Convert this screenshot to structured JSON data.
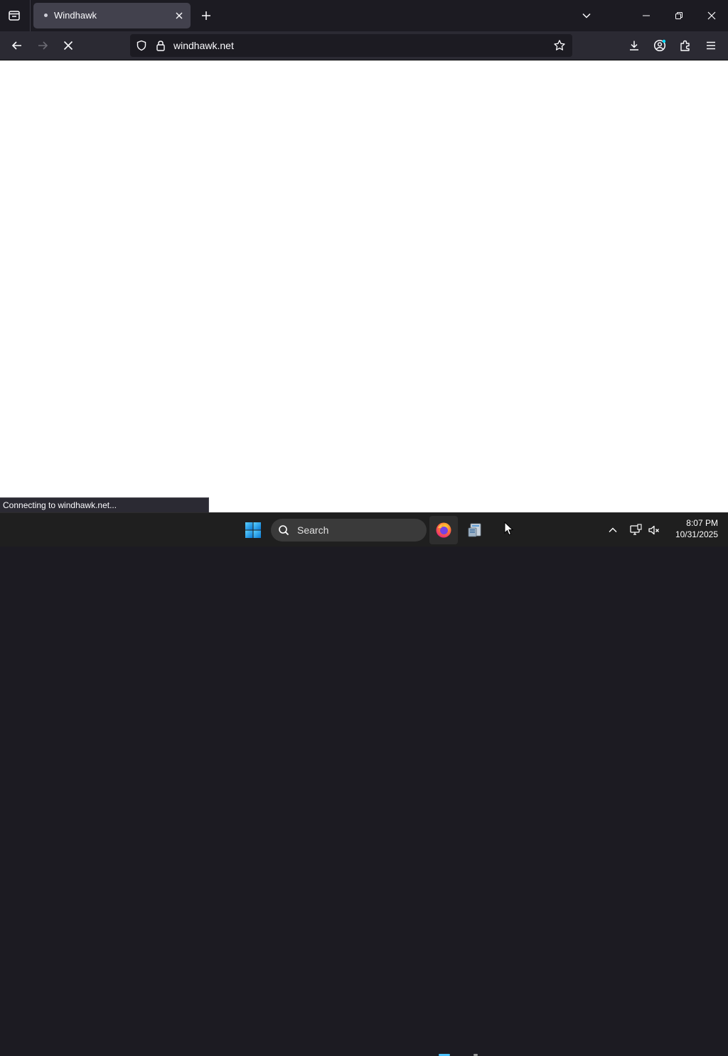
{
  "tabs": [
    {
      "title": "Windhawk",
      "active": true
    }
  ],
  "navbar": {
    "url": "windhawk.net",
    "loading": true
  },
  "status": {
    "text": "Connecting to windhawk.net..."
  },
  "taskbar": {
    "search_label": "Search",
    "apps": [
      "firefox-icon",
      "file-explorer-icon"
    ],
    "clock_time": "8:07 PM",
    "clock_date": "10/31/2025"
  },
  "colors": {
    "chrome_dark": "#1c1b22",
    "toolbar": "#2b2a33",
    "active_tab": "#42414d",
    "taskbar": "#1f1f1f",
    "accent_blue": "#4cc2ff"
  }
}
